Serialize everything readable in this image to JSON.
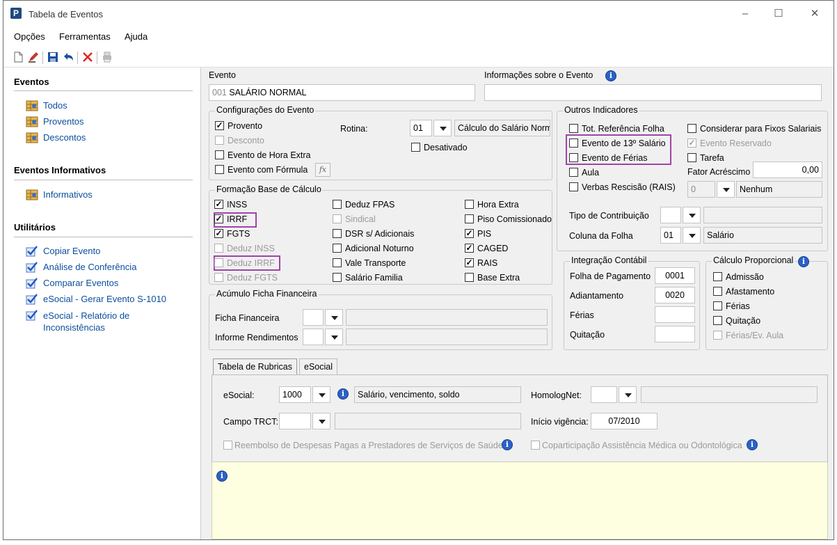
{
  "window": {
    "title": "Tabela de Eventos",
    "app_icon": "P"
  },
  "menu": [
    "Opções",
    "Ferramentas",
    "Ajuda"
  ],
  "sidebar": {
    "sections": [
      {
        "title": "Eventos",
        "items": [
          "Todos",
          "Proventos",
          "Descontos"
        ]
      },
      {
        "title": "Eventos Informativos",
        "items": [
          "Informativos"
        ]
      },
      {
        "title": "Utilitários",
        "items": [
          "Copiar Evento",
          "Análise de Conferência",
          "Comparar Eventos",
          "eSocial - Gerar Evento S-1010",
          "eSocial - Relatório de Inconsistências"
        ]
      }
    ]
  },
  "evento": {
    "label": "Evento",
    "code": "001",
    "name": "SALÁRIO NORMAL",
    "info_label": "Informações sobre o Evento",
    "info_value": ""
  },
  "config": {
    "title": "Configurações do Evento",
    "provento": {
      "label": "Provento",
      "checked": true
    },
    "desconto": {
      "label": "Desconto",
      "checked": false,
      "disabled": true
    },
    "hora_extra": {
      "label": "Evento de Hora Extra",
      "checked": false
    },
    "formula": {
      "label": "Evento com Fórmula",
      "checked": false
    },
    "formula_btn": "fx",
    "rotina_label": "Rotina:",
    "rotina_code": "01",
    "rotina_desc": "Cálculo do Salário Normal",
    "desativado": {
      "label": "Desativado",
      "checked": false
    }
  },
  "outros": {
    "title": "Outros Indicadores",
    "tot_ref": {
      "label": "Tot. Referência Folha",
      "checked": false
    },
    "ev13": {
      "label": "Evento de 13º Salário",
      "checked": false
    },
    "ferias": {
      "label": "Evento de Férias",
      "checked": false
    },
    "aula": {
      "label": "Aula",
      "checked": false
    },
    "verbas": {
      "label": "Verbas Rescisão (RAIS)",
      "checked": false
    },
    "fixos": {
      "label": "Considerar para Fixos Salariais",
      "checked": false
    },
    "reservado": {
      "label": "Evento Reservado",
      "checked": true,
      "disabled": true
    },
    "tarefa": {
      "label": "Tarefa",
      "checked": false
    },
    "fator_label": "Fator Acréscimo",
    "fator_value": "0,00",
    "verbas_code": "0",
    "verbas_desc": "Nenhum",
    "tipo_contrib_label": "Tipo de Contribuição",
    "tipo_contrib_value": "",
    "tipo_contrib_desc": "",
    "coluna_label": "Coluna da Folha",
    "coluna_code": "01",
    "coluna_desc": "Salário"
  },
  "base": {
    "title": "Formação Base de Cálculo",
    "items": [
      {
        "label": "INSS",
        "checked": true,
        "disabled": false
      },
      {
        "label": "IRRF",
        "checked": true,
        "disabled": false
      },
      {
        "label": "FGTS",
        "checked": true,
        "disabled": false
      },
      {
        "label": "Deduz INSS",
        "checked": false,
        "disabled": true
      },
      {
        "label": "Deduz IRRF",
        "checked": false,
        "disabled": true
      },
      {
        "label": "Deduz FGTS",
        "checked": false,
        "disabled": true
      },
      {
        "label": "Deduz FPAS",
        "checked": false,
        "disabled": false
      },
      {
        "label": "Sindical",
        "checked": false,
        "disabled": true
      },
      {
        "label": "DSR s/ Adicionais",
        "checked": false,
        "disabled": false
      },
      {
        "label": "Adicional Noturno",
        "checked": false,
        "disabled": false
      },
      {
        "label": "Vale Transporte",
        "checked": false,
        "disabled": false
      },
      {
        "label": "Salário Familia",
        "checked": false,
        "disabled": false
      },
      {
        "label": "Hora Extra",
        "checked": false,
        "disabled": false
      },
      {
        "label": "Piso Comissionado",
        "checked": false,
        "disabled": false
      },
      {
        "label": "PIS",
        "checked": true,
        "disabled": false
      },
      {
        "label": "CAGED",
        "checked": true,
        "disabled": false
      },
      {
        "label": "RAIS",
        "checked": true,
        "disabled": false
      },
      {
        "label": "Base Extra",
        "checked": false,
        "disabled": false
      }
    ]
  },
  "acumulo": {
    "title": "Acúmulo Ficha Financeira",
    "ficha_label": "Ficha Financeira",
    "informe_label": "Informe Rendimentos"
  },
  "integracao": {
    "title": "Integração Contábil",
    "rows": [
      {
        "label": "Folha de Pagamento",
        "value": "0001"
      },
      {
        "label": "Adiantamento",
        "value": "0020"
      },
      {
        "label": "Férias",
        "value": ""
      },
      {
        "label": "Quitação",
        "value": ""
      }
    ]
  },
  "proporcional": {
    "title": "Cálculo Proporcional",
    "items": [
      {
        "label": "Admissão",
        "checked": false,
        "disabled": false
      },
      {
        "label": "Afastamento",
        "checked": false,
        "disabled": false
      },
      {
        "label": "Férias",
        "checked": false,
        "disabled": false
      },
      {
        "label": "Quitação",
        "checked": false,
        "disabled": false
      },
      {
        "label": "Férias/Ev. Aula",
        "checked": false,
        "disabled": true
      }
    ]
  },
  "tabs": [
    "Tabela de Rubricas",
    "eSocial"
  ],
  "rubricas": {
    "esocial_label": "eSocial:",
    "esocial_code": "1000",
    "esocial_desc": "Salário, vencimento, soldo",
    "homolog_label": "HomologNet:",
    "homolog_value": "",
    "trct_label": "Campo TRCT:",
    "trct_value": "",
    "vigencia_label": "Início vigência:",
    "vigencia_value": "07/2010",
    "reembolso": {
      "label": "Reembolso de Despesas Pagas a Prestadores de Serviços de Saúde",
      "checked": false
    },
    "coparticipacao": {
      "label": "Coparticipação Assistência Médica ou Odontológica",
      "checked": false
    }
  },
  "colors": {
    "accent": "#0b4f9c",
    "highlight": "#a044a8",
    "note_bg": "#fefee1"
  }
}
